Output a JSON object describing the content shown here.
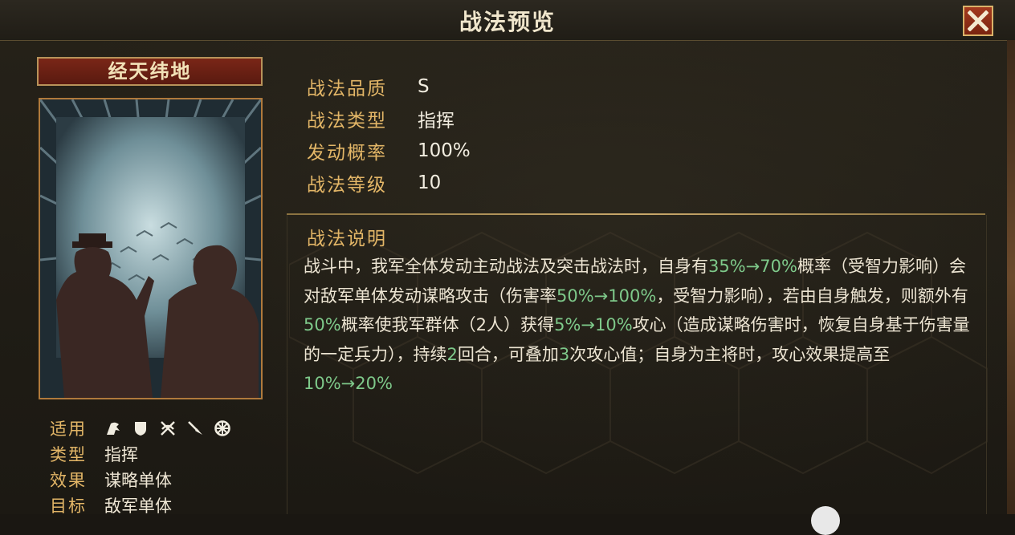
{
  "window": {
    "title": "战法预览"
  },
  "close_button": {
    "icon": "close-icon"
  },
  "skill": {
    "name": "经天纬地",
    "applicable_label": "适用",
    "applicable_icons": [
      "cavalry-icon",
      "shield-icon",
      "crossbow-icon",
      "spear-icon",
      "wheel-icon"
    ],
    "type_label": "类型",
    "type_value": "指挥",
    "effect_label": "效果",
    "effect_value": "谋略单体",
    "target_label": "目标",
    "target_value": "敌军单体"
  },
  "stats": [
    {
      "label": "战法品质",
      "value": "S"
    },
    {
      "label": "战法类型",
      "value": "指挥"
    },
    {
      "label": "发动概率",
      "value": "100%"
    },
    {
      "label": "战法等级",
      "value": "10"
    }
  ],
  "description": {
    "title": "战法说明",
    "segments": [
      {
        "t": "战斗中，我军全体发动主动战法及突击战法时，自身有",
        "hl": false
      },
      {
        "t": "35%→70%",
        "hl": true
      },
      {
        "t": "概率（受智力影响）会对敌军单体发动谋略攻击（伤害率",
        "hl": false
      },
      {
        "t": "50%→100%",
        "hl": true
      },
      {
        "t": "，受智力影响），若由自身触发，则额外有",
        "hl": false
      },
      {
        "t": "50%",
        "hl": true
      },
      {
        "t": "概率使我军群体（2人）获得",
        "hl": false
      },
      {
        "t": "5%→10%",
        "hl": true
      },
      {
        "t": "攻心（造成谋略伤害时，恢复自身基于伤害量的一定兵力），持续",
        "hl": false
      },
      {
        "t": "2",
        "hl": true
      },
      {
        "t": "回合，可叠加",
        "hl": false
      },
      {
        "t": "3",
        "hl": true
      },
      {
        "t": "次攻心值；自身为主将时，攻心效果提高至",
        "hl": false
      },
      {
        "t": "10%→20%",
        "hl": true
      }
    ]
  },
  "colors": {
    "label_gold": "#e3b667",
    "highlight_green": "#7ec98a",
    "text_light": "#ece4d2",
    "plate_red": "#7a2617"
  }
}
